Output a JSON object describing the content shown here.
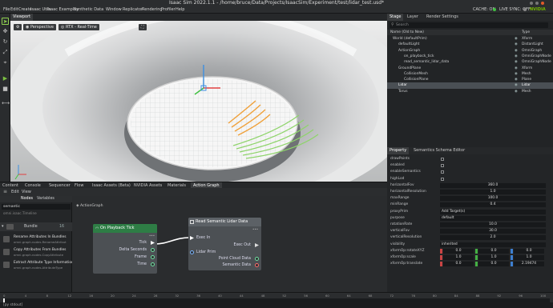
{
  "window": {
    "title": "Isaac Sim 2022.1.1 - /home/bruce/Data/Projects/IsaacSim/Experiment/test/lidar_test.usd*"
  },
  "menu": [
    "File",
    "Edit",
    "Create",
    "Isaac Utils",
    "Isaac Examples",
    "Synthetic Data",
    "Window",
    "Replicator",
    "Rendering",
    "Profiler",
    "Help"
  ],
  "menu_right": {
    "cache": "CACHE: ON",
    "sync": "LIVE SYNC: OFF",
    "nvidia": "NVIDIA"
  },
  "viewport": {
    "tab": "Viewport",
    "camera_label": "Perspective",
    "render_label": "RTX - Real-Time"
  },
  "stage": {
    "tabs": [
      "Stage",
      "Layer",
      "Render Settings"
    ],
    "search_placeholder": "Search",
    "col_name": "Name (Old to New)",
    "col_type": "Type",
    "rows": [
      {
        "name": "World (defaultPrim)",
        "type": "Xform",
        "indent": 1
      },
      {
        "name": "defaultLight",
        "type": "DistantLight",
        "indent": 2
      },
      {
        "name": "ActionGraph",
        "type": "OmniGraph",
        "indent": 2
      },
      {
        "name": "on_playback_tick",
        "type": "OmniGraphNode",
        "indent": 3
      },
      {
        "name": "read_semantic_lidar_data",
        "type": "OmniGraphNode",
        "indent": 3
      },
      {
        "name": "GroundPlane",
        "type": "Xform",
        "indent": 2
      },
      {
        "name": "CollisionMesh",
        "type": "Mesh",
        "indent": 3
      },
      {
        "name": "CollisionPlane",
        "type": "Plane",
        "indent": 3
      },
      {
        "name": "Lidar",
        "type": "Lidar",
        "indent": 2,
        "selected": true
      },
      {
        "name": "Torus",
        "type": "Mesh",
        "indent": 2
      }
    ]
  },
  "property": {
    "tabs": [
      "Property",
      "Semantics Schema Editor"
    ],
    "rows": [
      {
        "label": "drawPoints",
        "kind": "check"
      },
      {
        "label": "enabled",
        "kind": "check"
      },
      {
        "label": "enableSemantics",
        "kind": "check"
      },
      {
        "label": "highLod",
        "kind": "check"
      },
      {
        "label": "horizontalFov",
        "kind": "num",
        "value": "360.0"
      },
      {
        "label": "horizontalResolution",
        "kind": "num",
        "value": "1.0"
      },
      {
        "label": "maxRange",
        "kind": "num",
        "value": "100.0"
      },
      {
        "label": "minRange",
        "kind": "num",
        "value": "0.4"
      },
      {
        "label": "proxyPrim",
        "kind": "text",
        "value": "Add Target(s)"
      },
      {
        "label": "purpose",
        "kind": "select",
        "value": "default"
      },
      {
        "label": "rotationRate",
        "kind": "num",
        "value": "10.0"
      },
      {
        "label": "verticalFov",
        "kind": "num",
        "value": "30.0"
      },
      {
        "label": "verticalResolution",
        "kind": "num",
        "value": "2.0"
      },
      {
        "label": "visibility",
        "kind": "select",
        "value": "inherited"
      },
      {
        "label": "xformOp:rotateXYZ",
        "kind": "vec",
        "value": [
          "0.0",
          "0.0",
          "0.0"
        ]
      },
      {
        "label": "xformOp:scale",
        "kind": "vec",
        "value": [
          "1.0",
          "1.0",
          "1.0"
        ]
      },
      {
        "label": "xformOp:translate",
        "kind": "vec",
        "value": [
          "0.0",
          "0.0",
          "2.19474"
        ]
      }
    ]
  },
  "bottom": {
    "tabs": [
      "Content",
      "Console",
      "Sequencer",
      "Flow",
      "Isaac Assets (Beta)",
      "NVIDIA Assets",
      "Materials",
      "Action Graph"
    ],
    "graph_menu": [
      "Edit",
      "View"
    ],
    "panel_tabs": [
      "Nodes",
      "Variables"
    ],
    "search_value": "semantic",
    "header_item": "omni.isaac.Timeline",
    "bundle_label": "Bundle",
    "bundle_count": "16",
    "items": [
      {
        "title": "Rename Attributes In Bundles",
        "sub": "omni.graph.nodes.RenameAttribut"
      },
      {
        "title": "Copy Attributes From Bundles",
        "sub": "omni.graph.nodes.CopyAttribute"
      },
      {
        "title": "Extract Attribute Type Information",
        "sub": "omni.graph.nodes.AttributeType"
      }
    ],
    "graph_name": "ActionGraph",
    "node1": {
      "title": "On Playback Tick",
      "outputs": [
        "Tick",
        "Delta Seconds",
        "Frame",
        "Time"
      ]
    },
    "node2": {
      "title": "Read Semantic Lidar Data",
      "inputs": [
        "Exec In",
        "Lidar Prim"
      ],
      "outputs": [
        "Exec Out",
        "Point Cloud Data",
        "Semantic Data"
      ]
    }
  },
  "timeline": {
    "ticks": [
      "0",
      "4",
      "8",
      "12",
      "16",
      "20",
      "24",
      "28",
      "32",
      "36",
      "40",
      "44",
      "48",
      "52",
      "56",
      "60",
      "64",
      "68",
      "72",
      "76",
      "80",
      "84",
      "88",
      "92",
      "96",
      "100"
    ],
    "start": "0",
    "end": "100",
    "current_start": "0",
    "current_end": "100",
    "fps": "24.00 FPS"
  },
  "status": {
    "text": "[py stdout]"
  }
}
